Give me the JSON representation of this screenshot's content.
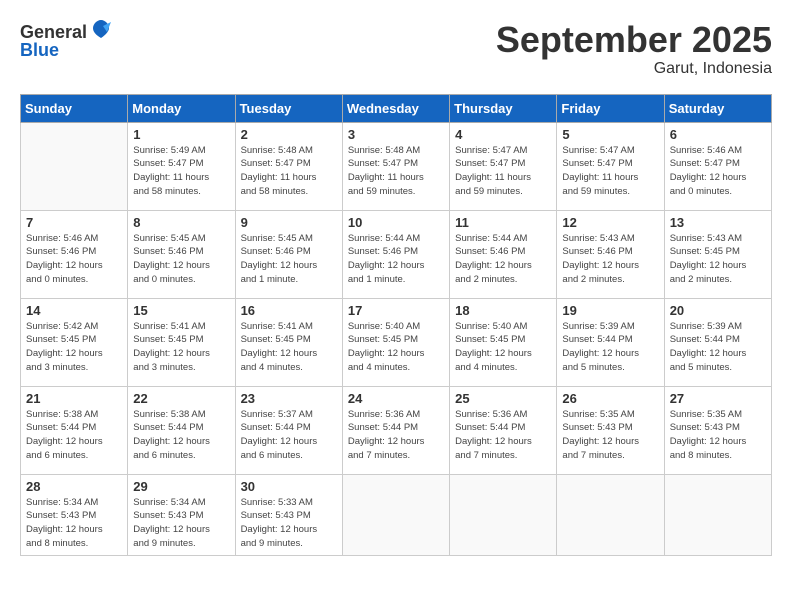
{
  "logo": {
    "text_general": "General",
    "text_blue": "Blue"
  },
  "title": "September 2025",
  "subtitle": "Garut, Indonesia",
  "weekdays": [
    "Sunday",
    "Monday",
    "Tuesday",
    "Wednesday",
    "Thursday",
    "Friday",
    "Saturday"
  ],
  "weeks": [
    [
      {
        "day": "",
        "info": ""
      },
      {
        "day": "1",
        "info": "Sunrise: 5:49 AM\nSunset: 5:47 PM\nDaylight: 11 hours\nand 58 minutes."
      },
      {
        "day": "2",
        "info": "Sunrise: 5:48 AM\nSunset: 5:47 PM\nDaylight: 11 hours\nand 58 minutes."
      },
      {
        "day": "3",
        "info": "Sunrise: 5:48 AM\nSunset: 5:47 PM\nDaylight: 11 hours\nand 59 minutes."
      },
      {
        "day": "4",
        "info": "Sunrise: 5:47 AM\nSunset: 5:47 PM\nDaylight: 11 hours\nand 59 minutes."
      },
      {
        "day": "5",
        "info": "Sunrise: 5:47 AM\nSunset: 5:47 PM\nDaylight: 11 hours\nand 59 minutes."
      },
      {
        "day": "6",
        "info": "Sunrise: 5:46 AM\nSunset: 5:47 PM\nDaylight: 12 hours\nand 0 minutes."
      }
    ],
    [
      {
        "day": "7",
        "info": "Sunrise: 5:46 AM\nSunset: 5:46 PM\nDaylight: 12 hours\nand 0 minutes."
      },
      {
        "day": "8",
        "info": "Sunrise: 5:45 AM\nSunset: 5:46 PM\nDaylight: 12 hours\nand 0 minutes."
      },
      {
        "day": "9",
        "info": "Sunrise: 5:45 AM\nSunset: 5:46 PM\nDaylight: 12 hours\nand 1 minute."
      },
      {
        "day": "10",
        "info": "Sunrise: 5:44 AM\nSunset: 5:46 PM\nDaylight: 12 hours\nand 1 minute."
      },
      {
        "day": "11",
        "info": "Sunrise: 5:44 AM\nSunset: 5:46 PM\nDaylight: 12 hours\nand 2 minutes."
      },
      {
        "day": "12",
        "info": "Sunrise: 5:43 AM\nSunset: 5:46 PM\nDaylight: 12 hours\nand 2 minutes."
      },
      {
        "day": "13",
        "info": "Sunrise: 5:43 AM\nSunset: 5:45 PM\nDaylight: 12 hours\nand 2 minutes."
      }
    ],
    [
      {
        "day": "14",
        "info": "Sunrise: 5:42 AM\nSunset: 5:45 PM\nDaylight: 12 hours\nand 3 minutes."
      },
      {
        "day": "15",
        "info": "Sunrise: 5:41 AM\nSunset: 5:45 PM\nDaylight: 12 hours\nand 3 minutes."
      },
      {
        "day": "16",
        "info": "Sunrise: 5:41 AM\nSunset: 5:45 PM\nDaylight: 12 hours\nand 4 minutes."
      },
      {
        "day": "17",
        "info": "Sunrise: 5:40 AM\nSunset: 5:45 PM\nDaylight: 12 hours\nand 4 minutes."
      },
      {
        "day": "18",
        "info": "Sunrise: 5:40 AM\nSunset: 5:45 PM\nDaylight: 12 hours\nand 4 minutes."
      },
      {
        "day": "19",
        "info": "Sunrise: 5:39 AM\nSunset: 5:44 PM\nDaylight: 12 hours\nand 5 minutes."
      },
      {
        "day": "20",
        "info": "Sunrise: 5:39 AM\nSunset: 5:44 PM\nDaylight: 12 hours\nand 5 minutes."
      }
    ],
    [
      {
        "day": "21",
        "info": "Sunrise: 5:38 AM\nSunset: 5:44 PM\nDaylight: 12 hours\nand 6 minutes."
      },
      {
        "day": "22",
        "info": "Sunrise: 5:38 AM\nSunset: 5:44 PM\nDaylight: 12 hours\nand 6 minutes."
      },
      {
        "day": "23",
        "info": "Sunrise: 5:37 AM\nSunset: 5:44 PM\nDaylight: 12 hours\nand 6 minutes."
      },
      {
        "day": "24",
        "info": "Sunrise: 5:36 AM\nSunset: 5:44 PM\nDaylight: 12 hours\nand 7 minutes."
      },
      {
        "day": "25",
        "info": "Sunrise: 5:36 AM\nSunset: 5:44 PM\nDaylight: 12 hours\nand 7 minutes."
      },
      {
        "day": "26",
        "info": "Sunrise: 5:35 AM\nSunset: 5:43 PM\nDaylight: 12 hours\nand 7 minutes."
      },
      {
        "day": "27",
        "info": "Sunrise: 5:35 AM\nSunset: 5:43 PM\nDaylight: 12 hours\nand 8 minutes."
      }
    ],
    [
      {
        "day": "28",
        "info": "Sunrise: 5:34 AM\nSunset: 5:43 PM\nDaylight: 12 hours\nand 8 minutes."
      },
      {
        "day": "29",
        "info": "Sunrise: 5:34 AM\nSunset: 5:43 PM\nDaylight: 12 hours\nand 9 minutes."
      },
      {
        "day": "30",
        "info": "Sunrise: 5:33 AM\nSunset: 5:43 PM\nDaylight: 12 hours\nand 9 minutes."
      },
      {
        "day": "",
        "info": ""
      },
      {
        "day": "",
        "info": ""
      },
      {
        "day": "",
        "info": ""
      },
      {
        "day": "",
        "info": ""
      }
    ]
  ]
}
